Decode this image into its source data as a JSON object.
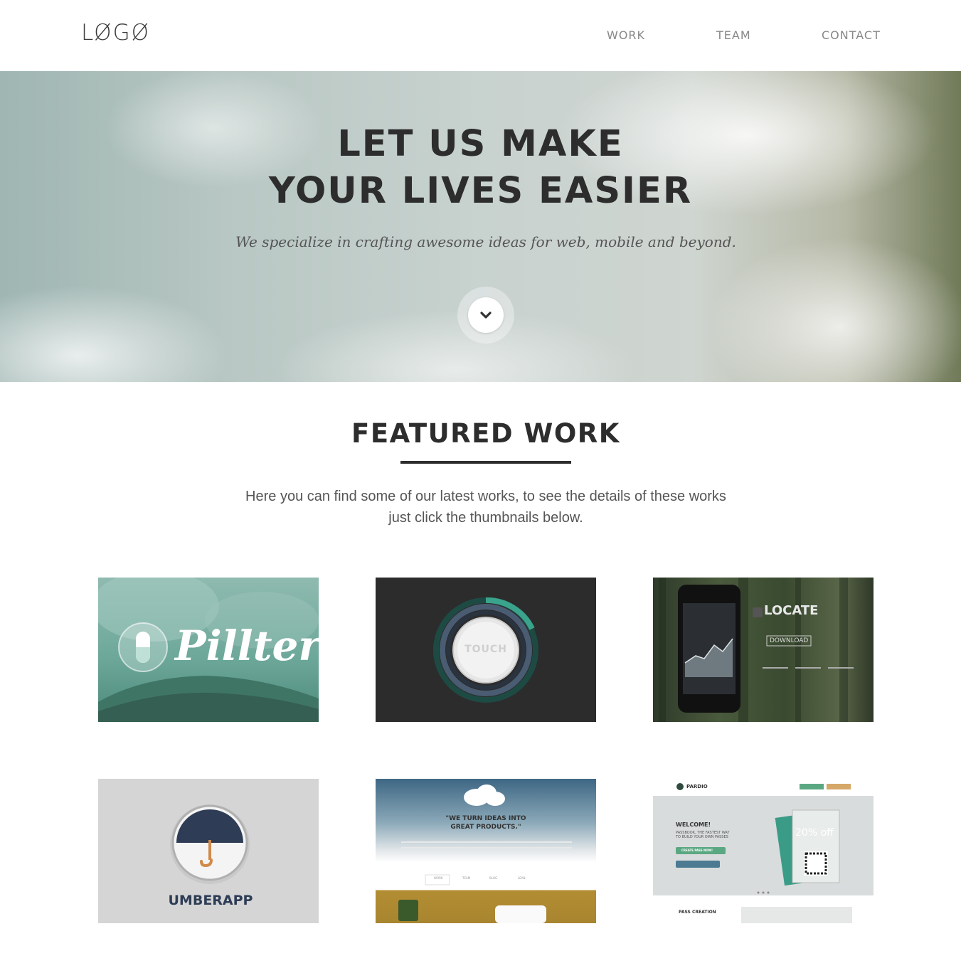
{
  "header": {
    "logo": "LØGØ",
    "nav": [
      "WORK",
      "TEAM",
      "CONTACT"
    ]
  },
  "hero": {
    "title_line1": "LET US MAKE",
    "title_line2": "YOUR LIVES EASIER",
    "subtitle": "We specialize in crafting awesome ideas for web, mobile and beyond.",
    "scroll_icon": "chevron-down-icon"
  },
  "featured": {
    "title": "FEATURED WORK",
    "description_line1": "Here you can find some of our latest works, to see the details of these works",
    "description_line2": "just click the thumbnails below.",
    "thumbnails": [
      {
        "text": "Pillter"
      },
      {
        "text": "TOUCH"
      },
      {
        "text": "LOCATE",
        "lines": [
          "DOWNLOAD"
        ]
      },
      {
        "text": "UMBERAPP"
      },
      {
        "text": "\"WE TURN IDEAS INTO GREAT PRODUCTS.\"",
        "nav": [
          "WORK",
          "TEAM",
          "BLOG",
          "LEAN"
        ]
      },
      {
        "text": "PARDIO",
        "lines": [
          "WELCOME!",
          "PASSBOOK, THE FASTEST WAY",
          "TO BUILD YOUR OWN PASSES",
          "CREATE PASS NOW!",
          "20% off",
          "PASS CREATION"
        ]
      }
    ]
  },
  "colors": {
    "text_dark": "#2d2d2d",
    "nav_text": "#888888",
    "accent_teal": "#3a9c86"
  }
}
